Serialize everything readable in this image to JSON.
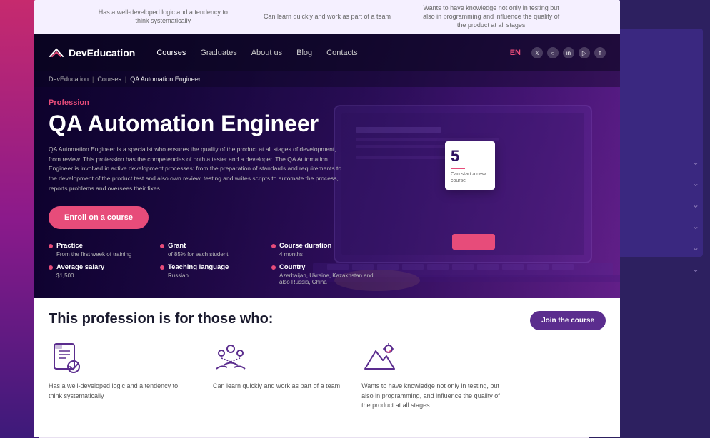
{
  "page": {
    "title": "QA Automation Engineer - DevEducation"
  },
  "bg": {
    "colors": {
      "left_gradient_start": "#c62a6e",
      "left_gradient_end": "#3d1a7a",
      "right_bg": "#2d2060",
      "accent": "#2d1060"
    }
  },
  "top_strip": {
    "items": [
      "Has a well-developed logic and a tendency to think systematically",
      "Can learn quickly and work as part of a team",
      "Wants to have knowledge not only in testing but also in programming and influence the quality of the product at all stages"
    ]
  },
  "navbar": {
    "logo_text": "DevEducation",
    "links": [
      {
        "label": "Courses",
        "active": true
      },
      {
        "label": "Graduates",
        "active": false
      },
      {
        "label": "About us",
        "active": false
      },
      {
        "label": "Blog",
        "active": false
      },
      {
        "label": "Contacts",
        "active": false
      }
    ],
    "lang": "EN",
    "social_icons": [
      "twitter",
      "instagram",
      "linkedin",
      "youtube",
      "facebook"
    ]
  },
  "breadcrumb": {
    "items": [
      "DevEducation",
      "Courses",
      "QA Automation Engineer"
    ],
    "separator": "|"
  },
  "hero": {
    "profession_label": "Profession",
    "title": "QA Automation Engineer",
    "description": "QA Automation Engineer is a specialist who ensures the quality of the product at all stages of development, from review. This profession has the competencies of both a tester and a developer. The QA Automation Engineer is involved in active development processes: from the preparation of standards and requirements to the development of the product test and also own review, testing and writes scripts to automate the process, reports problems and oversees their fixes.",
    "enroll_button": "Enroll on a course"
  },
  "stats": [
    {
      "label": "Practice",
      "value": "From the first week of training"
    },
    {
      "label": "Grant",
      "value": "of 85% for each student"
    },
    {
      "label": "Course duration",
      "value": "4 months"
    },
    {
      "label": "Average salary",
      "value": "$1,500"
    },
    {
      "label": "Teaching language",
      "value": "Russian"
    },
    {
      "label": "Country",
      "value": "Azerbaijan, Ukraine, Kazakhstan and also Russia, China"
    }
  ],
  "right_card": {
    "number": "5",
    "text": "Can start a new course"
  },
  "bottom": {
    "join_button": "Join the course",
    "section_title": "This profession is for those who:",
    "features": [
      {
        "icon": "checklist-icon",
        "text": "Has a well-developed logic and a tendency to think systematically"
      },
      {
        "icon": "team-icon",
        "text": "Can learn quickly and work as part of a team"
      },
      {
        "icon": "mountain-icon",
        "text": "Wants to have knowledge not only in testing, but also in programming, and influence the quality of the product at all stages"
      }
    ]
  },
  "right_sidebar": {
    "chevrons": [
      "chevron-down",
      "chevron-down",
      "chevron-down",
      "chevron-down",
      "chevron-down",
      "chevron-down"
    ]
  }
}
